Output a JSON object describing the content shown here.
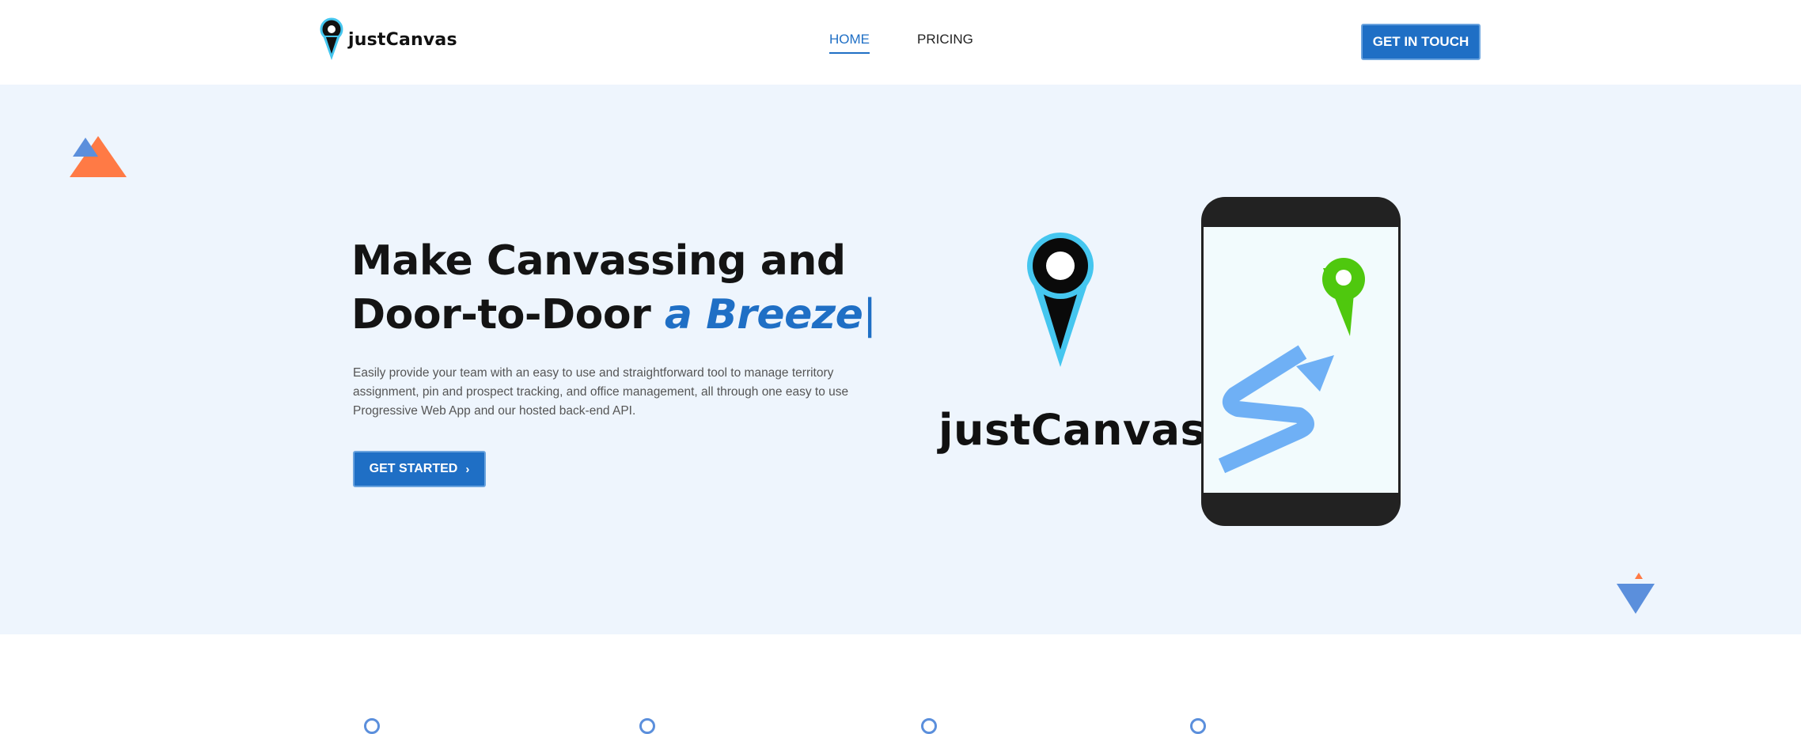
{
  "header": {
    "brand": "justCanvas",
    "nav": [
      {
        "label": "HOME",
        "active": true
      },
      {
        "label": "PRICING",
        "active": false
      }
    ],
    "cta_label": "GET IN TOUCH"
  },
  "hero": {
    "headline_line1": "Make Canvassing and",
    "headline_line2_prefix": "Door-to-Door ",
    "headline_accent": "a Breeze",
    "headline_cursor": "|",
    "description": "Easily provide your team with an easy to use and straightforward tool to manage territory assignment, pin and prospect tracking, and office management, all through one easy to use Progressive Web App and our hosted back-end API.",
    "cta_label": "GET STARTED",
    "cta_icon": "chevron-right-icon",
    "illustration_brand": "justCanvas"
  },
  "colors": {
    "accent": "#1f6fc5",
    "hero_bg": "#eef5fd",
    "pin_cyan": "#45c6ef",
    "pin_green": "#4fc80e",
    "arrow_blue": "#6fb0f5",
    "deco_orange": "#ff7a45",
    "deco_blue": "#5b8fdc"
  }
}
